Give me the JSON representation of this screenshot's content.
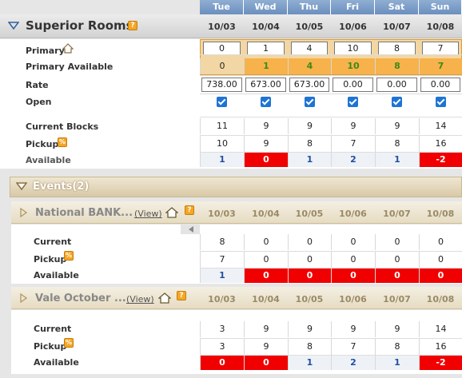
{
  "days": [
    "Tue",
    "Wed",
    "Thu",
    "Fri",
    "Sat",
    "Sun"
  ],
  "dates": [
    "10/03",
    "10/04",
    "10/05",
    "10/06",
    "10/07",
    "10/08"
  ],
  "room": {
    "title": "Superior Rooms",
    "labels": {
      "primary": "Primary",
      "primary_available": "Primary Available",
      "rate": "Rate",
      "open": "Open",
      "current_blocks": "Current Blocks",
      "pickup": "Pickup",
      "available": "Available"
    },
    "primary": [
      "0",
      "1",
      "4",
      "10",
      "8",
      "7"
    ],
    "primary_available": [
      "0",
      "1",
      "4",
      "10",
      "8",
      "7"
    ],
    "rate": [
      "738.00",
      "673.00",
      "673.00",
      "0.00",
      "0.00",
      "0.00"
    ],
    "current_blocks": [
      "11",
      "9",
      "9",
      "9",
      "9",
      "14"
    ],
    "pickup": [
      "10",
      "9",
      "8",
      "7",
      "8",
      "16"
    ],
    "available": [
      "1",
      "0",
      "1",
      "2",
      "1",
      "-2"
    ]
  },
  "events": {
    "title": "Events(2)",
    "list": [
      {
        "name": "National BANK...",
        "view": "(View)",
        "labels": {
          "current": "Current",
          "pickup": "Pickup",
          "available": "Available"
        },
        "current": [
          "8",
          "0",
          "0",
          "0",
          "0",
          "0"
        ],
        "pickup": [
          "7",
          "0",
          "0",
          "0",
          "0",
          "0"
        ],
        "available": [
          "1",
          "0",
          "0",
          "0",
          "0",
          "0"
        ]
      },
      {
        "name": "Vale October ...",
        "view": "(View)",
        "labels": {
          "current": "Current",
          "pickup": "Pickup",
          "available": "Available"
        },
        "current": [
          "3",
          "9",
          "9",
          "9",
          "9",
          "14"
        ],
        "pickup": [
          "3",
          "9",
          "8",
          "7",
          "8",
          "16"
        ],
        "available": [
          "0",
          "0",
          "1",
          "2",
          "1",
          "-2"
        ]
      }
    ]
  },
  "colors": {
    "header_blue": "#6b8fbe",
    "alert_red": "#f00000",
    "highlight_orange": "#f7b24b",
    "event_tan": "#d8c9a6"
  }
}
